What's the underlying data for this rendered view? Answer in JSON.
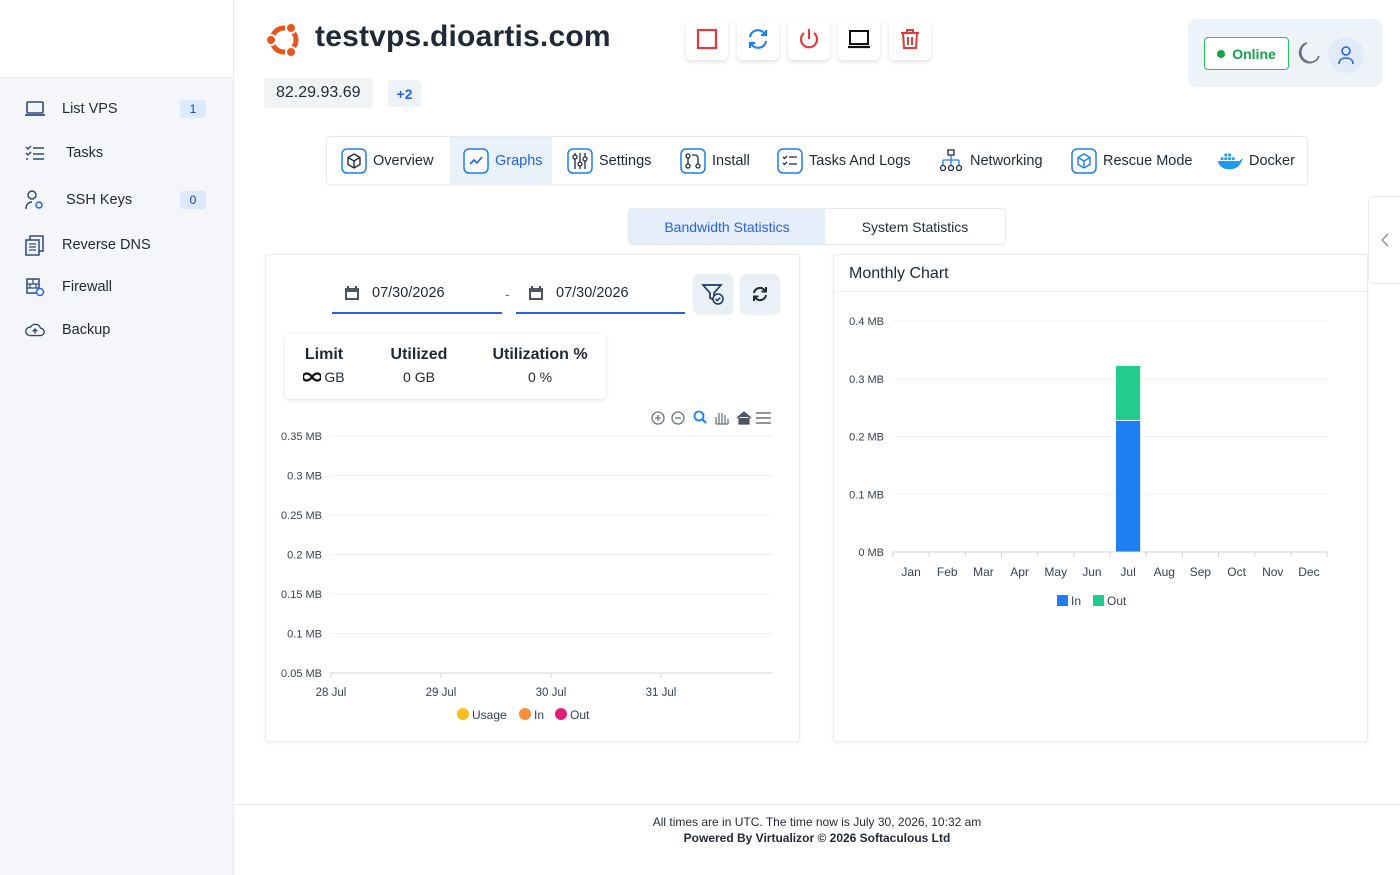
{
  "sidebar": {
    "items": [
      {
        "label": "List VPS",
        "badge": "1",
        "icon": "laptop-icon"
      },
      {
        "label": "Tasks",
        "icon": "checklist-icon"
      },
      {
        "label": "SSH Keys",
        "badge": "0",
        "icon": "user-key-icon"
      },
      {
        "label": "Reverse DNS",
        "icon": "documents-icon"
      },
      {
        "label": "Firewall",
        "icon": "firewall-icon"
      },
      {
        "label": "Backup",
        "icon": "cloud-upload-icon"
      }
    ]
  },
  "header": {
    "title": "testvps.dioartis.com",
    "ip": "82.29.93.69",
    "more_ips": "+2",
    "status": "Online",
    "actions": [
      "stop-icon",
      "restart-icon",
      "power-icon",
      "console-icon",
      "trash-icon"
    ]
  },
  "tabs": [
    {
      "label": "Overview",
      "icon": "cube-icon"
    },
    {
      "label": "Graphs",
      "icon": "graph-icon",
      "active": true
    },
    {
      "label": "Settings",
      "icon": "sliders-icon"
    },
    {
      "label": "Install",
      "icon": "git-icon"
    },
    {
      "label": "Tasks And Logs",
      "icon": "task-list-icon"
    },
    {
      "label": "Networking",
      "icon": "network-icon"
    },
    {
      "label": "Rescue Mode",
      "icon": "rescue-cube-icon"
    },
    {
      "label": "Docker",
      "icon": "docker-icon"
    }
  ],
  "subtabs": [
    {
      "label": "Bandwidth Statistics",
      "active": true
    },
    {
      "label": "System Statistics"
    }
  ],
  "filters": {
    "date_from": "07/30/2026",
    "date_to": "07/30/2026",
    "separator": "-"
  },
  "stats": {
    "limit_label": "Limit",
    "limit_value": "GB",
    "utilized_label": "Utilized",
    "utilized_value": "0 GB",
    "utilization_label": "Utilization %",
    "utilization_value": "0 %"
  },
  "monthly_title": "Monthly Chart",
  "colors": {
    "accent": "#2563eb",
    "online": "#16a34a",
    "usage": "#fbbf24",
    "in_line": "#fb8c3c",
    "out_line": "#e11d74",
    "in_bar": "#1d7ff0",
    "out_bar": "#22cc8f"
  },
  "chart_data": [
    {
      "type": "line",
      "x": [
        "28 Jul",
        "29 Jul",
        "30 Jul",
        "31 Jul"
      ],
      "yticks": [
        "0.35 MB",
        "0.3 MB",
        "0.25 MB",
        "0.2 MB",
        "0.15 MB",
        "0.1 MB",
        "0.05 MB"
      ],
      "ylim": [
        0.05,
        0.35
      ],
      "series": [
        {
          "name": "Usage",
          "values": []
        },
        {
          "name": "In",
          "values": []
        },
        {
          "name": "Out",
          "values": []
        }
      ],
      "legend": "bottom"
    },
    {
      "type": "bar",
      "stacked": true,
      "categories": [
        "Jan",
        "Feb",
        "Mar",
        "Apr",
        "May",
        "Jun",
        "Jul",
        "Aug",
        "Sep",
        "Oct",
        "Nov",
        "Dec"
      ],
      "yticks": [
        "0 MB",
        "0.1 MB",
        "0.2 MB",
        "0.3 MB",
        "0.4 MB"
      ],
      "ylim": [
        0,
        0.4
      ],
      "series": [
        {
          "name": "In",
          "values": [
            0,
            0,
            0,
            0,
            0,
            0,
            0.228,
            0,
            0,
            0,
            0,
            0
          ]
        },
        {
          "name": "Out",
          "values": [
            0,
            0,
            0,
            0,
            0,
            0,
            0.095,
            0,
            0,
            0,
            0,
            0
          ]
        }
      ],
      "legend": "bottom"
    }
  ],
  "footer": {
    "line1": "All times are in UTC. The time now is July 30, 2026, 10:32 am",
    "line2": "Powered By Virtualizor © 2026 Softaculous Ltd"
  }
}
